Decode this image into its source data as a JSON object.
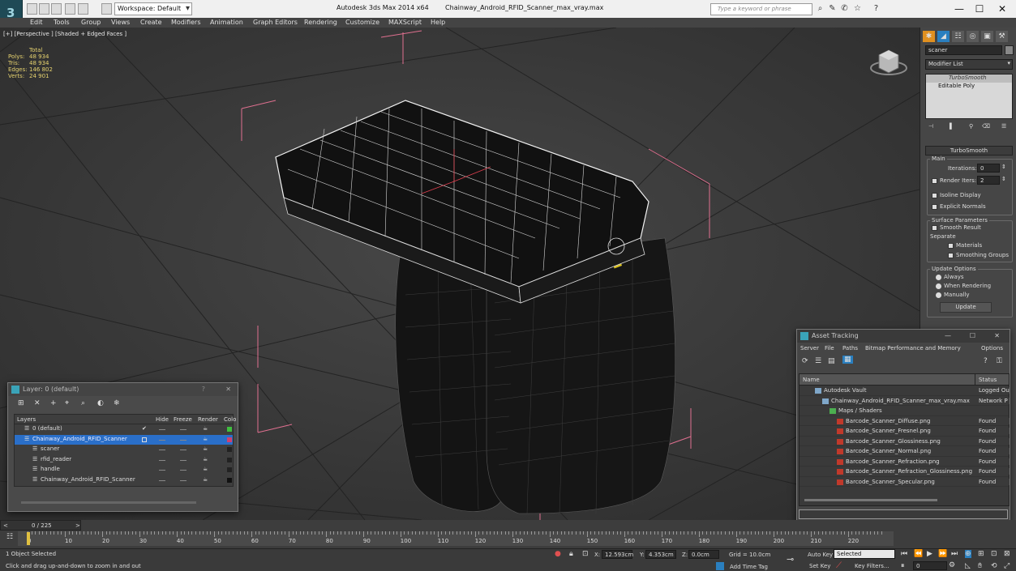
{
  "titlebar": {
    "app_title": "Autodesk 3ds Max  2014 x64",
    "file_name": "Chainway_Android_RFID_Scanner_max_vray.max",
    "workspace": "Workspace: Default",
    "search_placeholder": "Type a keyword or phrase",
    "min": "—",
    "max": "☐",
    "close": "✕"
  },
  "menu": [
    "Edit",
    "Tools",
    "Group",
    "Views",
    "Create",
    "Modifiers",
    "Animation",
    "Graph Editors",
    "Rendering",
    "Customize",
    "MAXScript",
    "Help"
  ],
  "viewport": {
    "label": "[+] [Perspective ] [Shaded + Edged Faces ]",
    "stats_header": "Total",
    "stats": [
      {
        "label": "Polys:",
        "value": "48 934"
      },
      {
        "label": "Tris:",
        "value": "48 934"
      },
      {
        "label": "Edges:",
        "value": "146 802"
      },
      {
        "label": "Verts:",
        "value": "24 901"
      }
    ]
  },
  "command_panel": {
    "object_name": "scaner",
    "modifier_list": "Modifier List",
    "stack": [
      "TurboSmooth",
      "Editable Poly"
    ],
    "rollout_title": "TurboSmooth",
    "main_group": "Main",
    "iterations_label": "Iterations:",
    "iterations_value": "0",
    "render_iters_label": "Render Iters:",
    "render_iters_value": "2",
    "isoline": "Isoline Display",
    "explicit_normals": "Explicit Normals",
    "surface_group": "Surface Parameters",
    "smooth_result": "Smooth Result",
    "separate": "Separate",
    "materials": "Materials",
    "smoothing_groups": "Smoothing Groups",
    "update_group": "Update Options",
    "always": "Always",
    "when_rendering": "When Rendering",
    "manually": "Manually",
    "update_btn": "Update"
  },
  "layer_window": {
    "title": "Layer: 0 (default)",
    "help": "?",
    "close": "✕",
    "columns": [
      "Layers",
      "Hide",
      "Freeze",
      "Render",
      "Colo"
    ],
    "rows": [
      {
        "name": "0 (default)",
        "indent": 0,
        "color": "#3fbf3f",
        "selected": false
      },
      {
        "name": "Chainway_Android_RFID_Scanner",
        "indent": 0,
        "color": "#d04070",
        "selected": true
      },
      {
        "name": "scaner",
        "indent": 1,
        "color": "#222222",
        "selected": false
      },
      {
        "name": "rfid_reader",
        "indent": 1,
        "color": "#222222",
        "selected": false
      },
      {
        "name": "handle",
        "indent": 1,
        "color": "#222222",
        "selected": false
      },
      {
        "name": "Chainway_Android_RFID_Scanner",
        "indent": 1,
        "color": "#111111",
        "selected": false
      }
    ]
  },
  "asset_window": {
    "title": "Asset Tracking",
    "menu": [
      "Server",
      "File",
      "Paths",
      "Bitmap Performance and Memory",
      "Options"
    ],
    "columns": [
      "Name",
      "Status"
    ],
    "rows": [
      {
        "name": "Autodesk Vault",
        "status": "Logged Ou",
        "indent": 1
      },
      {
        "name": "Chainway_Android_RFID_Scanner_max_vray.max",
        "status": "Network P",
        "indent": 2
      },
      {
        "name": "Maps / Shaders",
        "status": "",
        "indent": 3
      },
      {
        "name": "Barcode_Scanner_Diffuse.png",
        "status": "Found",
        "indent": 4
      },
      {
        "name": "Barcode_Scanner_Fresnel.png",
        "status": "Found",
        "indent": 4
      },
      {
        "name": "Barcode_Scanner_Glossiness.png",
        "status": "Found",
        "indent": 4
      },
      {
        "name": "Barcode_Scanner_Normal.png",
        "status": "Found",
        "indent": 4
      },
      {
        "name": "Barcode_Scanner_Refraction.png",
        "status": "Found",
        "indent": 4
      },
      {
        "name": "Barcode_Scanner_Refraction_Glossiness.png",
        "status": "Found",
        "indent": 4
      },
      {
        "name": "Barcode_Scanner_Specular.png",
        "status": "Found",
        "indent": 4
      }
    ]
  },
  "timeline": {
    "frame": "0 / 225",
    "ticks": [
      "0",
      "10",
      "20",
      "30",
      "40",
      "50",
      "60",
      "70",
      "80",
      "90",
      "100",
      "110",
      "120",
      "130",
      "140",
      "150",
      "160",
      "170",
      "180",
      "190",
      "200",
      "210",
      "220"
    ]
  },
  "status": {
    "selection": "1 Object Selected",
    "prompt": "Click and drag up-and-down to zoom in and out",
    "x_label": "X:",
    "x_value": "12.593cm",
    "y_label": "Y:",
    "y_value": "4.353cm",
    "z_label": "Z:",
    "z_value": "0.0cm",
    "grid": "Grid = 10.0cm",
    "auto_key": "Auto Key",
    "selected": "Selected",
    "set_key": "Set Key",
    "key_filters": "Key Filters...",
    "add_time_tag": "Add Time Tag",
    "frame_field": "0"
  }
}
